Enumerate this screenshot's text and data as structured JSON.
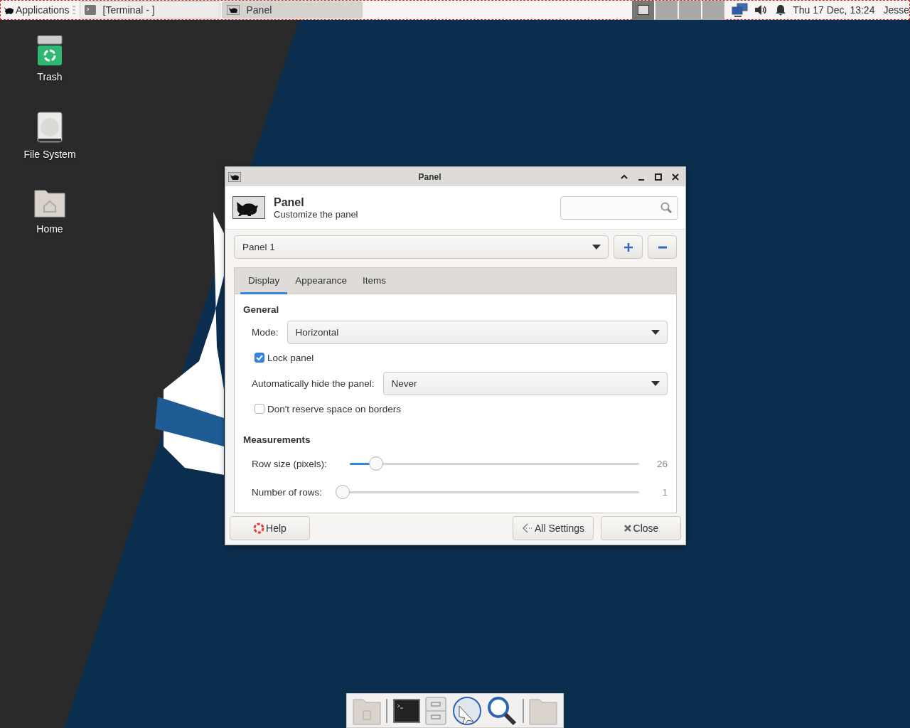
{
  "top_panel": {
    "menu_label": "Applications",
    "tasks": [
      {
        "label": "[Terminal - ]",
        "kind": "terminal",
        "selected": false
      },
      {
        "label": "Panel",
        "kind": "panel",
        "selected": true
      }
    ],
    "workspaces": [
      {
        "selected": true
      },
      {
        "selected": false
      },
      {
        "selected": false
      },
      {
        "selected": false
      }
    ],
    "clock": "Thu 17 Dec, 13:24",
    "user": "Jesse"
  },
  "desktop_icons": [
    {
      "label": "Trash",
      "kind": "trash"
    },
    {
      "label": "File System",
      "kind": "drive"
    },
    {
      "label": "Home",
      "kind": "home"
    }
  ],
  "window": {
    "title": "Panel",
    "header": {
      "title": "Panel",
      "subtitle": "Customize the panel"
    },
    "panel_select": "Panel 1",
    "tabs": [
      {
        "label": "Display",
        "selected": true
      },
      {
        "label": "Appearance",
        "selected": false
      },
      {
        "label": "Items",
        "selected": false
      }
    ],
    "general": {
      "heading": "General",
      "mode_label": "Mode:",
      "mode_value": "Horizontal",
      "lock_panel": {
        "label": "Lock panel",
        "checked": true
      },
      "autohide_label": "Automatically hide the panel:",
      "autohide_value": "Never",
      "reserve_space": {
        "label": "Don't reserve space on borders",
        "checked": false
      }
    },
    "measurements": {
      "heading": "Measurements",
      "sliders": [
        {
          "label": "Row size (pixels):",
          "level": 0.09,
          "reading": "26"
        },
        {
          "label": "Number of rows:",
          "level": 0,
          "reading": "1"
        }
      ]
    },
    "buttons": [
      {
        "label": "Help",
        "kind": "help"
      },
      {
        "label": "All Settings",
        "kind": "settings"
      },
      {
        "label": "Close",
        "kind": "close"
      }
    ]
  }
}
